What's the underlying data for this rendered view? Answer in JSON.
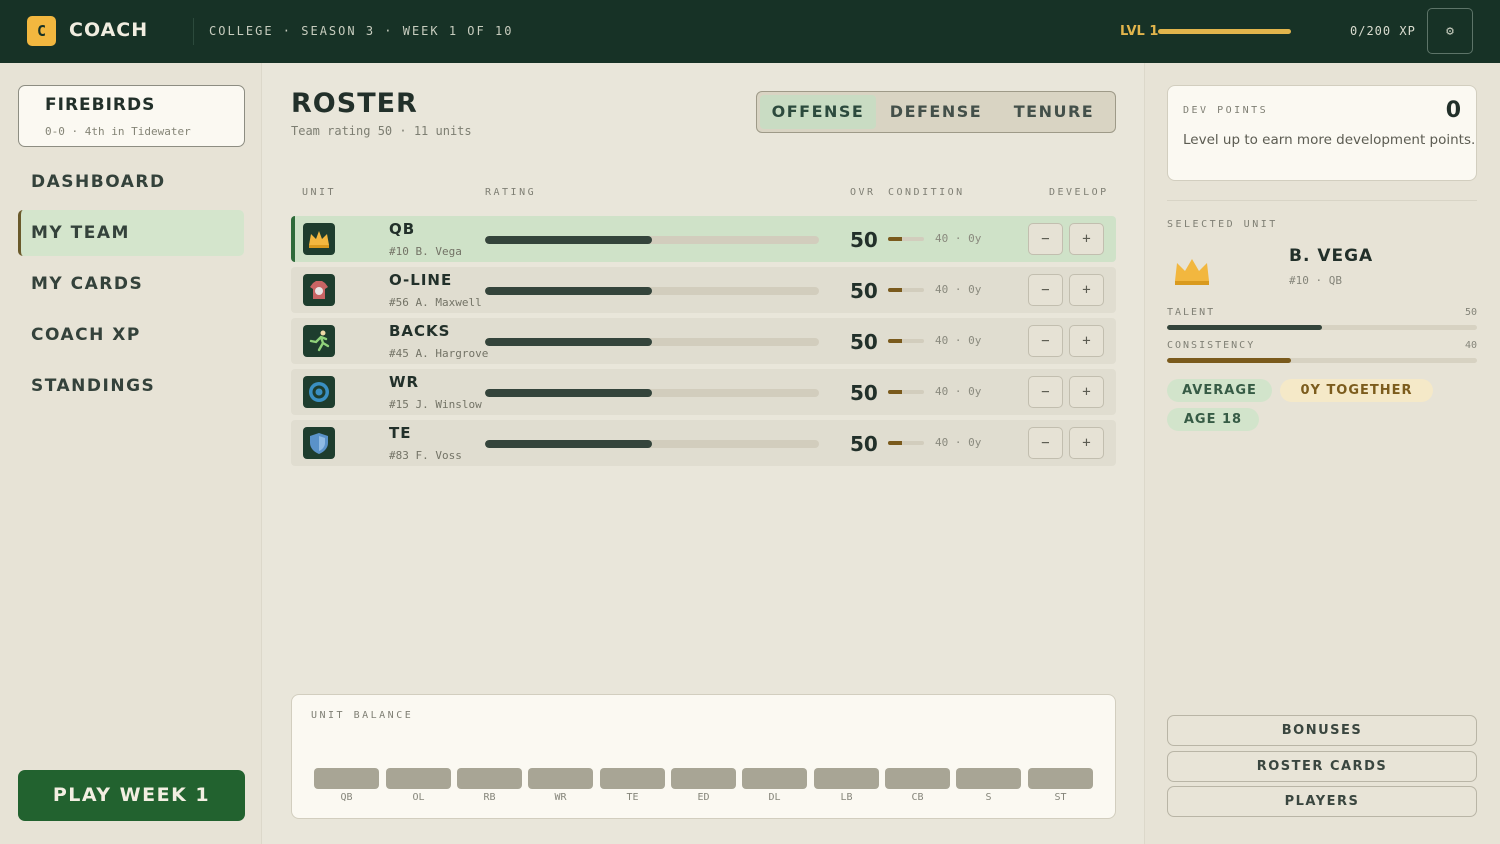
{
  "app": {
    "logo_letter": "C",
    "logo_text": "COACH"
  },
  "header": {
    "breadcrumb": "COLLEGE · SEASON 3 · WEEK 1 OF 10",
    "level": "LVL 1",
    "xp_text": "0/200 XP",
    "xp_progress": 1.0,
    "settings_icon": "⚙"
  },
  "team": {
    "name": "FIREBIRDS",
    "record": "0-0 · 4th in Tidewater"
  },
  "nav": [
    {
      "label": "DASHBOARD",
      "active": false
    },
    {
      "label": "MY TEAM",
      "active": true
    },
    {
      "label": "MY CARDS",
      "active": false
    },
    {
      "label": "COACH XP",
      "active": false
    },
    {
      "label": "STANDINGS",
      "active": false
    }
  ],
  "play_button": "PLAY WEEK 1",
  "roster": {
    "title": "ROSTER",
    "subtitle": "Team rating 50 · 11 units",
    "tabs": [
      {
        "label": "OFFENSE",
        "active": true
      },
      {
        "label": "DEFENSE",
        "active": false
      },
      {
        "label": "TENURE",
        "active": false
      }
    ],
    "columns": {
      "unit": "UNIT",
      "rating": "RATING",
      "ovr": "OVR",
      "condition": "CONDITION",
      "develop": "DEVELOP"
    },
    "rows": [
      {
        "unit": "QB",
        "player": "#10 B. Vega",
        "ovr": "50",
        "rating": 0.5,
        "condition": 0.4,
        "cond_text": "40 · 0y",
        "icon": "crown-icon",
        "selected": true
      },
      {
        "unit": "O-LINE",
        "player": "#56 A. Maxwell",
        "ovr": "50",
        "rating": 0.5,
        "condition": 0.4,
        "cond_text": "40 · 0y",
        "icon": "shirt-icon",
        "selected": false
      },
      {
        "unit": "BACKS",
        "player": "#45 A. Hargrove",
        "ovr": "50",
        "rating": 0.5,
        "condition": 0.4,
        "cond_text": "40 · 0y",
        "icon": "runner-icon",
        "selected": false
      },
      {
        "unit": "WR",
        "player": "#15 J. Winslow",
        "ovr": "50",
        "rating": 0.5,
        "condition": 0.4,
        "cond_text": "40 · 0y",
        "icon": "target-icon",
        "selected": false
      },
      {
        "unit": "TE",
        "player": "#83 F. Voss",
        "ovr": "50",
        "rating": 0.5,
        "condition": 0.4,
        "cond_text": "40 · 0y",
        "icon": "shield-icon",
        "selected": false
      }
    ],
    "develop_minus": "−",
    "develop_plus": "+"
  },
  "balance": {
    "label": "UNIT BALANCE",
    "units": [
      "QB",
      "OL",
      "RB",
      "WR",
      "TE",
      "ED",
      "DL",
      "LB",
      "CB",
      "S",
      "ST"
    ]
  },
  "dev_points": {
    "label": "DEV POINTS",
    "value": "0",
    "note": "Level up to earn more development points."
  },
  "selected_unit": {
    "label": "SELECTED UNIT",
    "name": "B. VEGA",
    "sub": "#10 · QB",
    "talent_label": "TALENT",
    "talent_value": "50",
    "talent": 0.5,
    "consistency_label": "CONSISTENCY",
    "consistency_value": "40",
    "consistency": 0.4,
    "tags": [
      "AVERAGE",
      "0Y TOGETHER",
      "AGE 18"
    ]
  },
  "right_buttons": [
    "BONUSES",
    "ROSTER CARDS",
    "PLAYERS"
  ],
  "colors": {
    "header": "#173226",
    "accent_gold": "#e2b54c",
    "play_green": "#22622f",
    "selected_row": "#cfe2c8"
  }
}
